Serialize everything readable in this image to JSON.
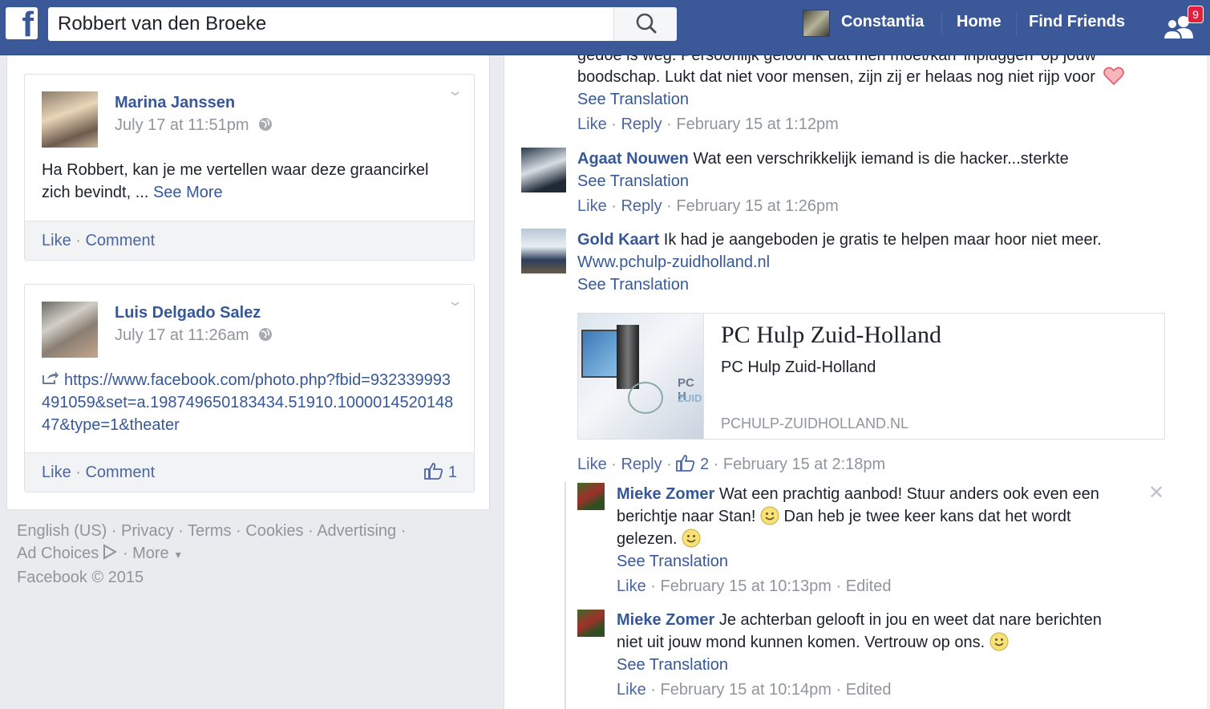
{
  "colors": {
    "brand": "#3b5998",
    "link": "#365899",
    "muted": "#90949c",
    "badge": "#e41e3f"
  },
  "topbar": {
    "logo": "f",
    "search_value": "Robbert van den Broeke",
    "user_name": "Constantia",
    "nav_home": "Home",
    "nav_find_friends": "Find Friends",
    "friend_requests_count": "9"
  },
  "left": {
    "posts": [
      {
        "author": "Marina Janssen",
        "timestamp": "July 17 at 11:51pm",
        "text": "Ha Robbert, kan je me vertellen waar deze graancirkel zich bevindt, ... ",
        "see_more": "See More",
        "like": "Like",
        "comment": "Comment"
      },
      {
        "author": "Luis Delgado Salez",
        "timestamp": "July 17 at 11:26am",
        "link": "https://www.facebook.com/photo.php?fbid=932339993491059&set=a.198749650183434.51910.100001452014847&type=1&theater",
        "like": "Like",
        "comment": "Comment",
        "likes_count": "1"
      }
    ],
    "footer": {
      "english": "English (US)",
      "privacy": "Privacy",
      "terms": "Terms",
      "cookies": "Cookies",
      "advertising": "Advertising",
      "ad_choices": "Ad Choices",
      "more": "More",
      "copyright": "Facebook © 2015"
    }
  },
  "comments": {
    "first": {
      "partial_line": "gedoe is weg. Persoonlijk geloof ik dat men moet/kan 'inpluggen' op jouw",
      "text": "boodschap. Lukt dat niet voor mensen, zijn zij er helaas nog niet rijp voor",
      "see_translation": "See Translation",
      "like": "Like",
      "reply": "Reply",
      "time": "February 15 at 1:12pm"
    },
    "agaat": {
      "name": "Agaat Nouwen",
      "text": " Wat een verschrikkelijk iemand is die hacker...sterkte",
      "see_translation": "See Translation",
      "like": "Like",
      "reply": "Reply",
      "time": "February 15 at 1:26pm"
    },
    "gold": {
      "name": "Gold Kaart",
      "text": " Ik had je aangeboden je gratis te helpen maar hoor niet meer.",
      "url": "Www.pchulp-zuidholland.nl",
      "see_translation": "See Translation",
      "card_title": "PC Hulp Zuid-Holland",
      "card_subtitle": "PC Hulp Zuid-Holland",
      "card_domain": "PCHULP-ZUIDHOLLAND.NL",
      "card_img_text1": "PC H",
      "card_img_text2": "ZUID",
      "like": "Like",
      "reply": "Reply",
      "likes_count": "2",
      "time": "February 15 at 2:18pm"
    },
    "mieke1": {
      "name": "Mieke Zomer",
      "line1": " Wat een prachtig aanbod! Stuur anders ook even een",
      "line2a": "berichtje naar Stan! ",
      "line2b": " Dan heb je twee keer kans dat het wordt",
      "line3": "gelezen. ",
      "see_translation": "See Translation",
      "like": "Like",
      "time": "February 15 at 10:13pm",
      "edited": "Edited"
    },
    "mieke2": {
      "name": "Mieke Zomer",
      "line1": " Je achterban gelooft in jou en weet dat nare berichten",
      "line2": "niet uit jouw mond kunnen komen. Vertrouw op ons. ",
      "see_translation": "See Translation",
      "like": "Like",
      "time": "February 15 at 10:14pm",
      "edited": "Edited"
    }
  }
}
